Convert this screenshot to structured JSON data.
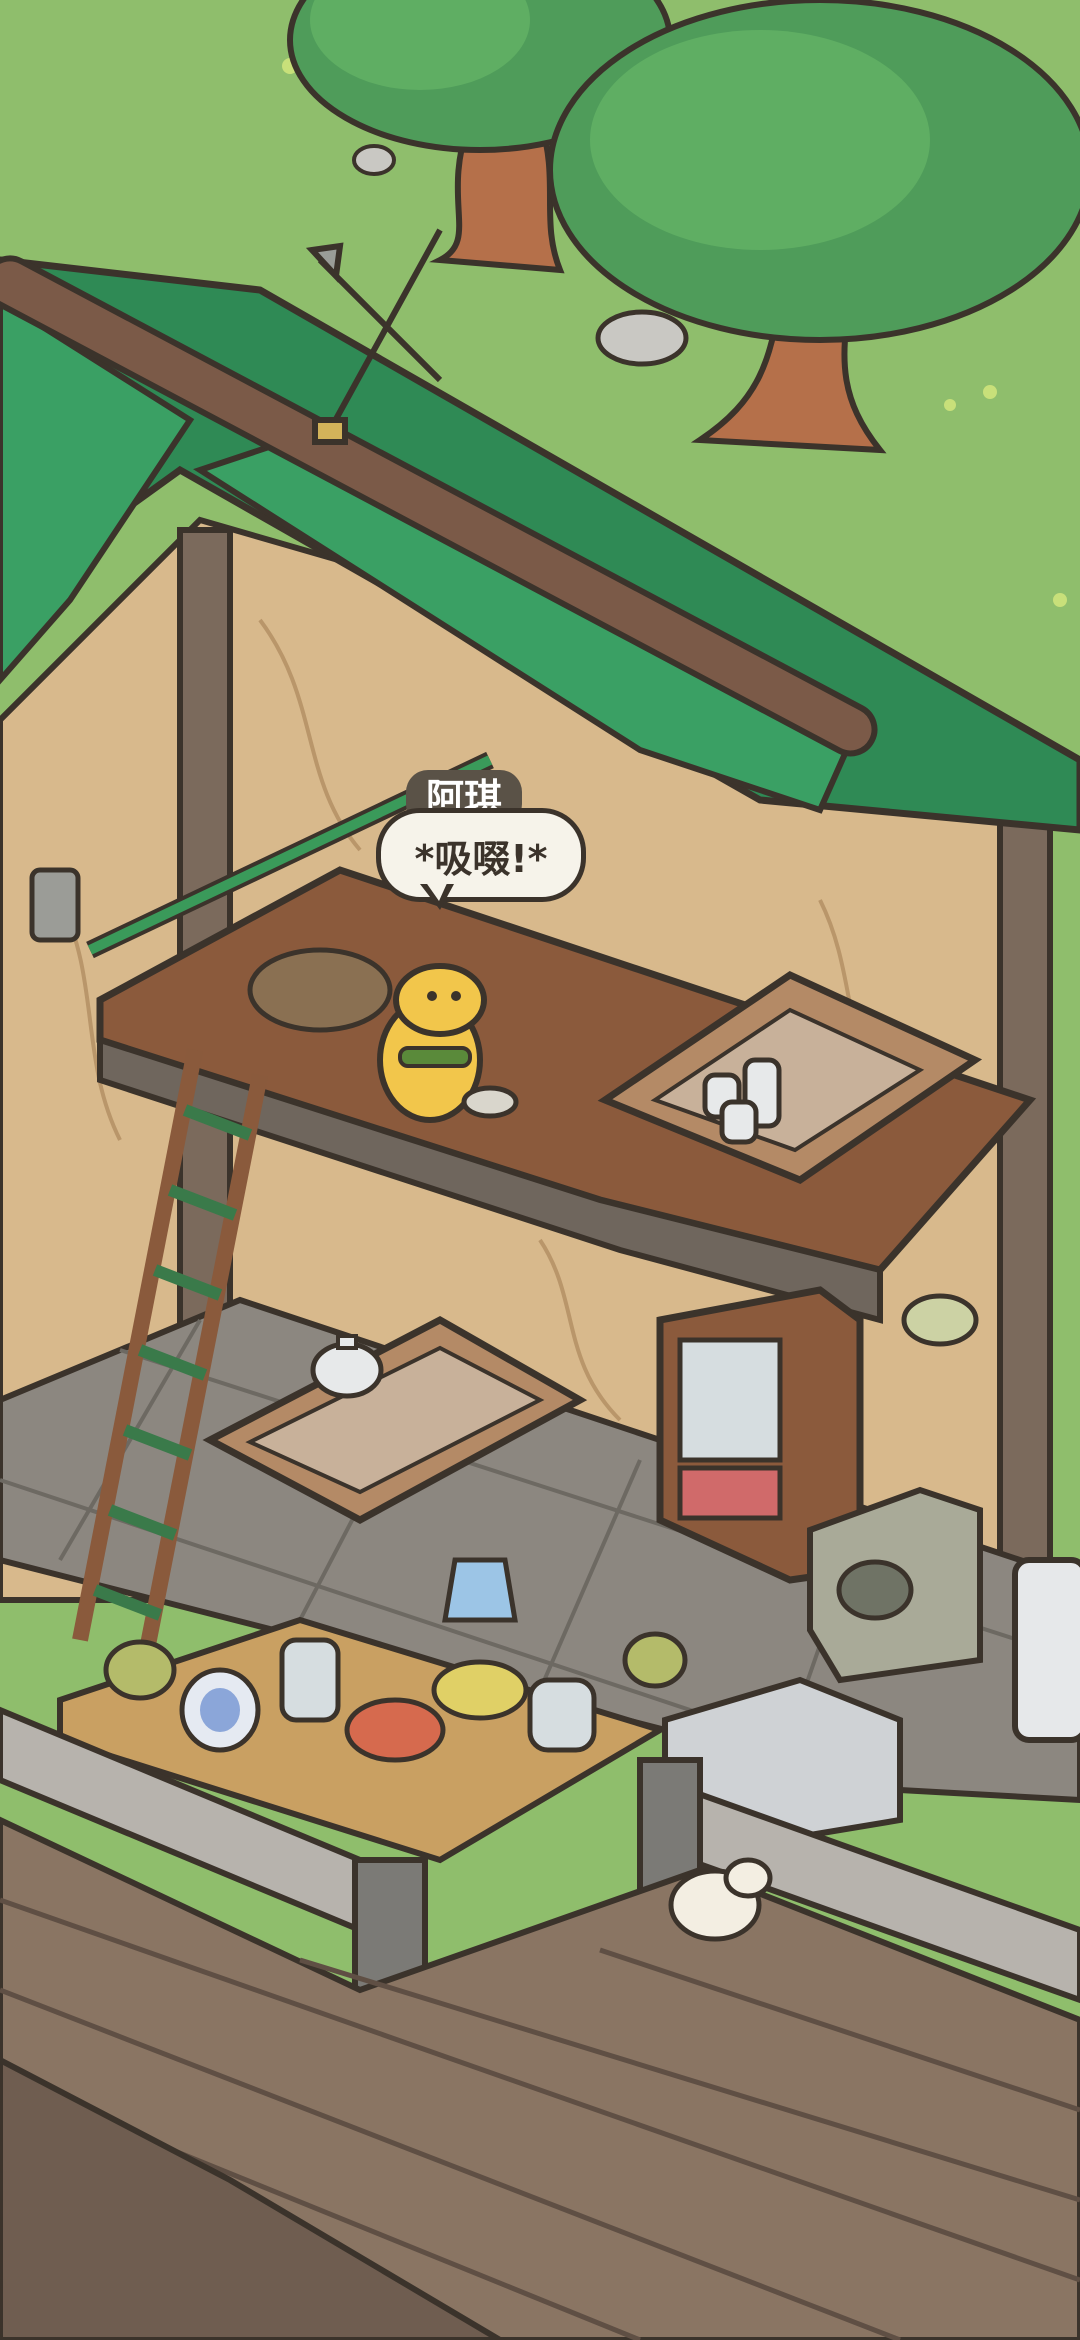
{
  "game": {
    "scene": "cottage-interior",
    "character": {
      "name": "阿琪",
      "speech": "*吸啜!*"
    }
  },
  "colors": {
    "grass": "#8fbe6c",
    "roof": "#2f8a55",
    "wall": "#d8b98c",
    "floor": "#8b5a3c",
    "tile": "#8c8780",
    "deck": "#8a7563",
    "outline": "#3b332b"
  },
  "icons": [
    "tree-icon",
    "weathervane-icon",
    "ladder-icon",
    "teapot-icon",
    "candle-icon",
    "cabinet-icon",
    "stove-icon",
    "kettle-icon",
    "jar-icon",
    "plate-icon",
    "hamster-icon",
    "giraffe-character-icon",
    "rock-icon"
  ]
}
